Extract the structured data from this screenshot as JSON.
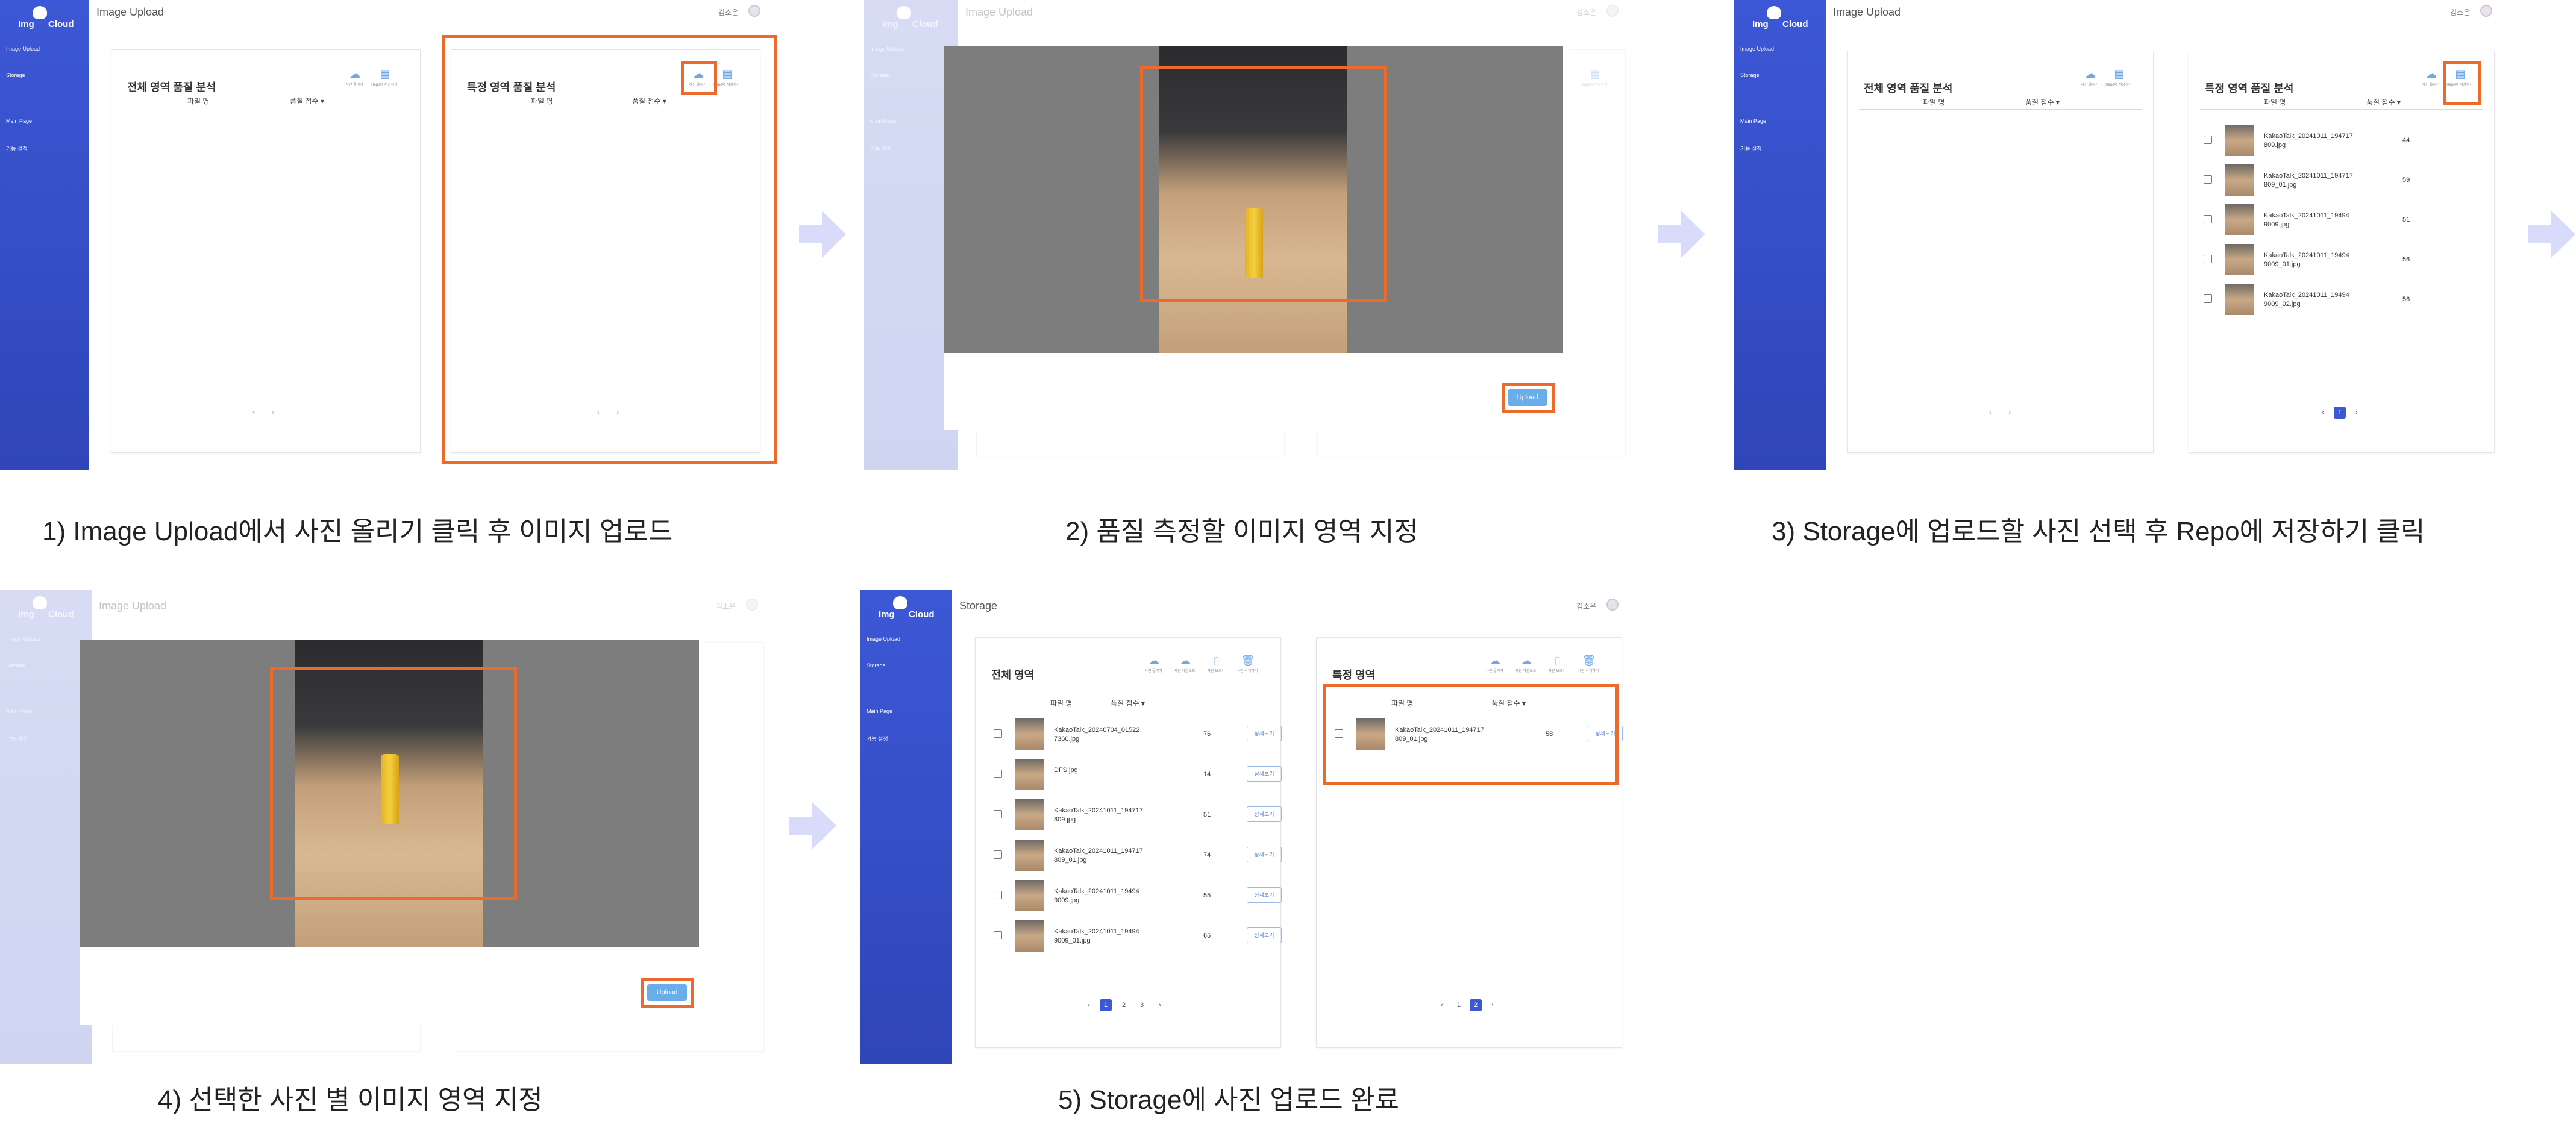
{
  "app": {
    "logo_img": "Img",
    "logo_cloud": "Cloud",
    "user_name": "김소은"
  },
  "nav": {
    "image_upload": "Image Upload",
    "storage": "Storage",
    "main_page": "Main Page",
    "settings": "기능 설정"
  },
  "page_titles": {
    "upload": "Image Upload",
    "storage": "Storage"
  },
  "cards": {
    "full_analysis": "전체 영역 품질 분석",
    "partial_analysis": "특정 영역 품질 분석",
    "full_area": "전체 영역",
    "partial_area": "특정 영역"
  },
  "table": {
    "col_filename": "파일 명",
    "col_score": "품질 점수 ▾"
  },
  "icons": {
    "upload_photo": {
      "name": "cloud-upload-icon",
      "label": "사진 올리기"
    },
    "save_repo": {
      "name": "folder-icon",
      "label": "Repo에 저장하기"
    },
    "download": {
      "name": "cloud-download-icon",
      "label": "사진 다운로드"
    },
    "report": {
      "name": "document-icon",
      "label": "사진 보고서"
    },
    "delete": {
      "name": "trash-icon",
      "label": "사진 삭제하기"
    }
  },
  "upload_button": "Upload",
  "detail_button": "상세보기",
  "pager": {
    "prev": "‹",
    "next": "›",
    "p1": "1",
    "p2": "2",
    "p3": "3"
  },
  "captions": {
    "s1": "1) Image Upload에서 사진 올리기 클릭 후 이미지 업로드",
    "s2": "2) 품질 측정할 이미지 영역 지정",
    "s3": "3) Storage에 업로드할 사진 선택 후 Repo에 저장하기 클릭",
    "s4": "4) 선택한 사진 별 이미지 영역 지정",
    "s5": "5) Storage에 사진 업로드 완료"
  },
  "step3_rows": [
    {
      "name": "KakaoTalk_20241011_194717\n809.jpg",
      "score": "44"
    },
    {
      "name": "KakaoTalk_20241011_194717\n809_01.jpg",
      "score": "59"
    },
    {
      "name": "KakaoTalk_20241011_19494\n9009.jpg",
      "score": "51"
    },
    {
      "name": "KakaoTalk_20241011_19494\n9009_01.jpg",
      "score": "56"
    },
    {
      "name": "KakaoTalk_20241011_19494\n9009_02.jpg",
      "score": "56"
    }
  ],
  "step5_full_rows": [
    {
      "name": "KakaoTalk_20240704_01522\n7360.jpg",
      "score": "76"
    },
    {
      "name": "DFS.jpg",
      "score": "14"
    },
    {
      "name": "KakaoTalk_20241011_194717\n809.jpg",
      "score": "51"
    },
    {
      "name": "KakaoTalk_20241011_194717\n809_01.jpg",
      "score": "74"
    },
    {
      "name": "KakaoTalk_20241011_19494\n9009.jpg",
      "score": "55"
    },
    {
      "name": "KakaoTalk_20241011_19494\n9009_01.jpg",
      "score": "65"
    }
  ],
  "step5_partial_rows": [
    {
      "name": "KakaoTalk_20241011_194717\n809_01.jpg",
      "score": "58"
    }
  ]
}
